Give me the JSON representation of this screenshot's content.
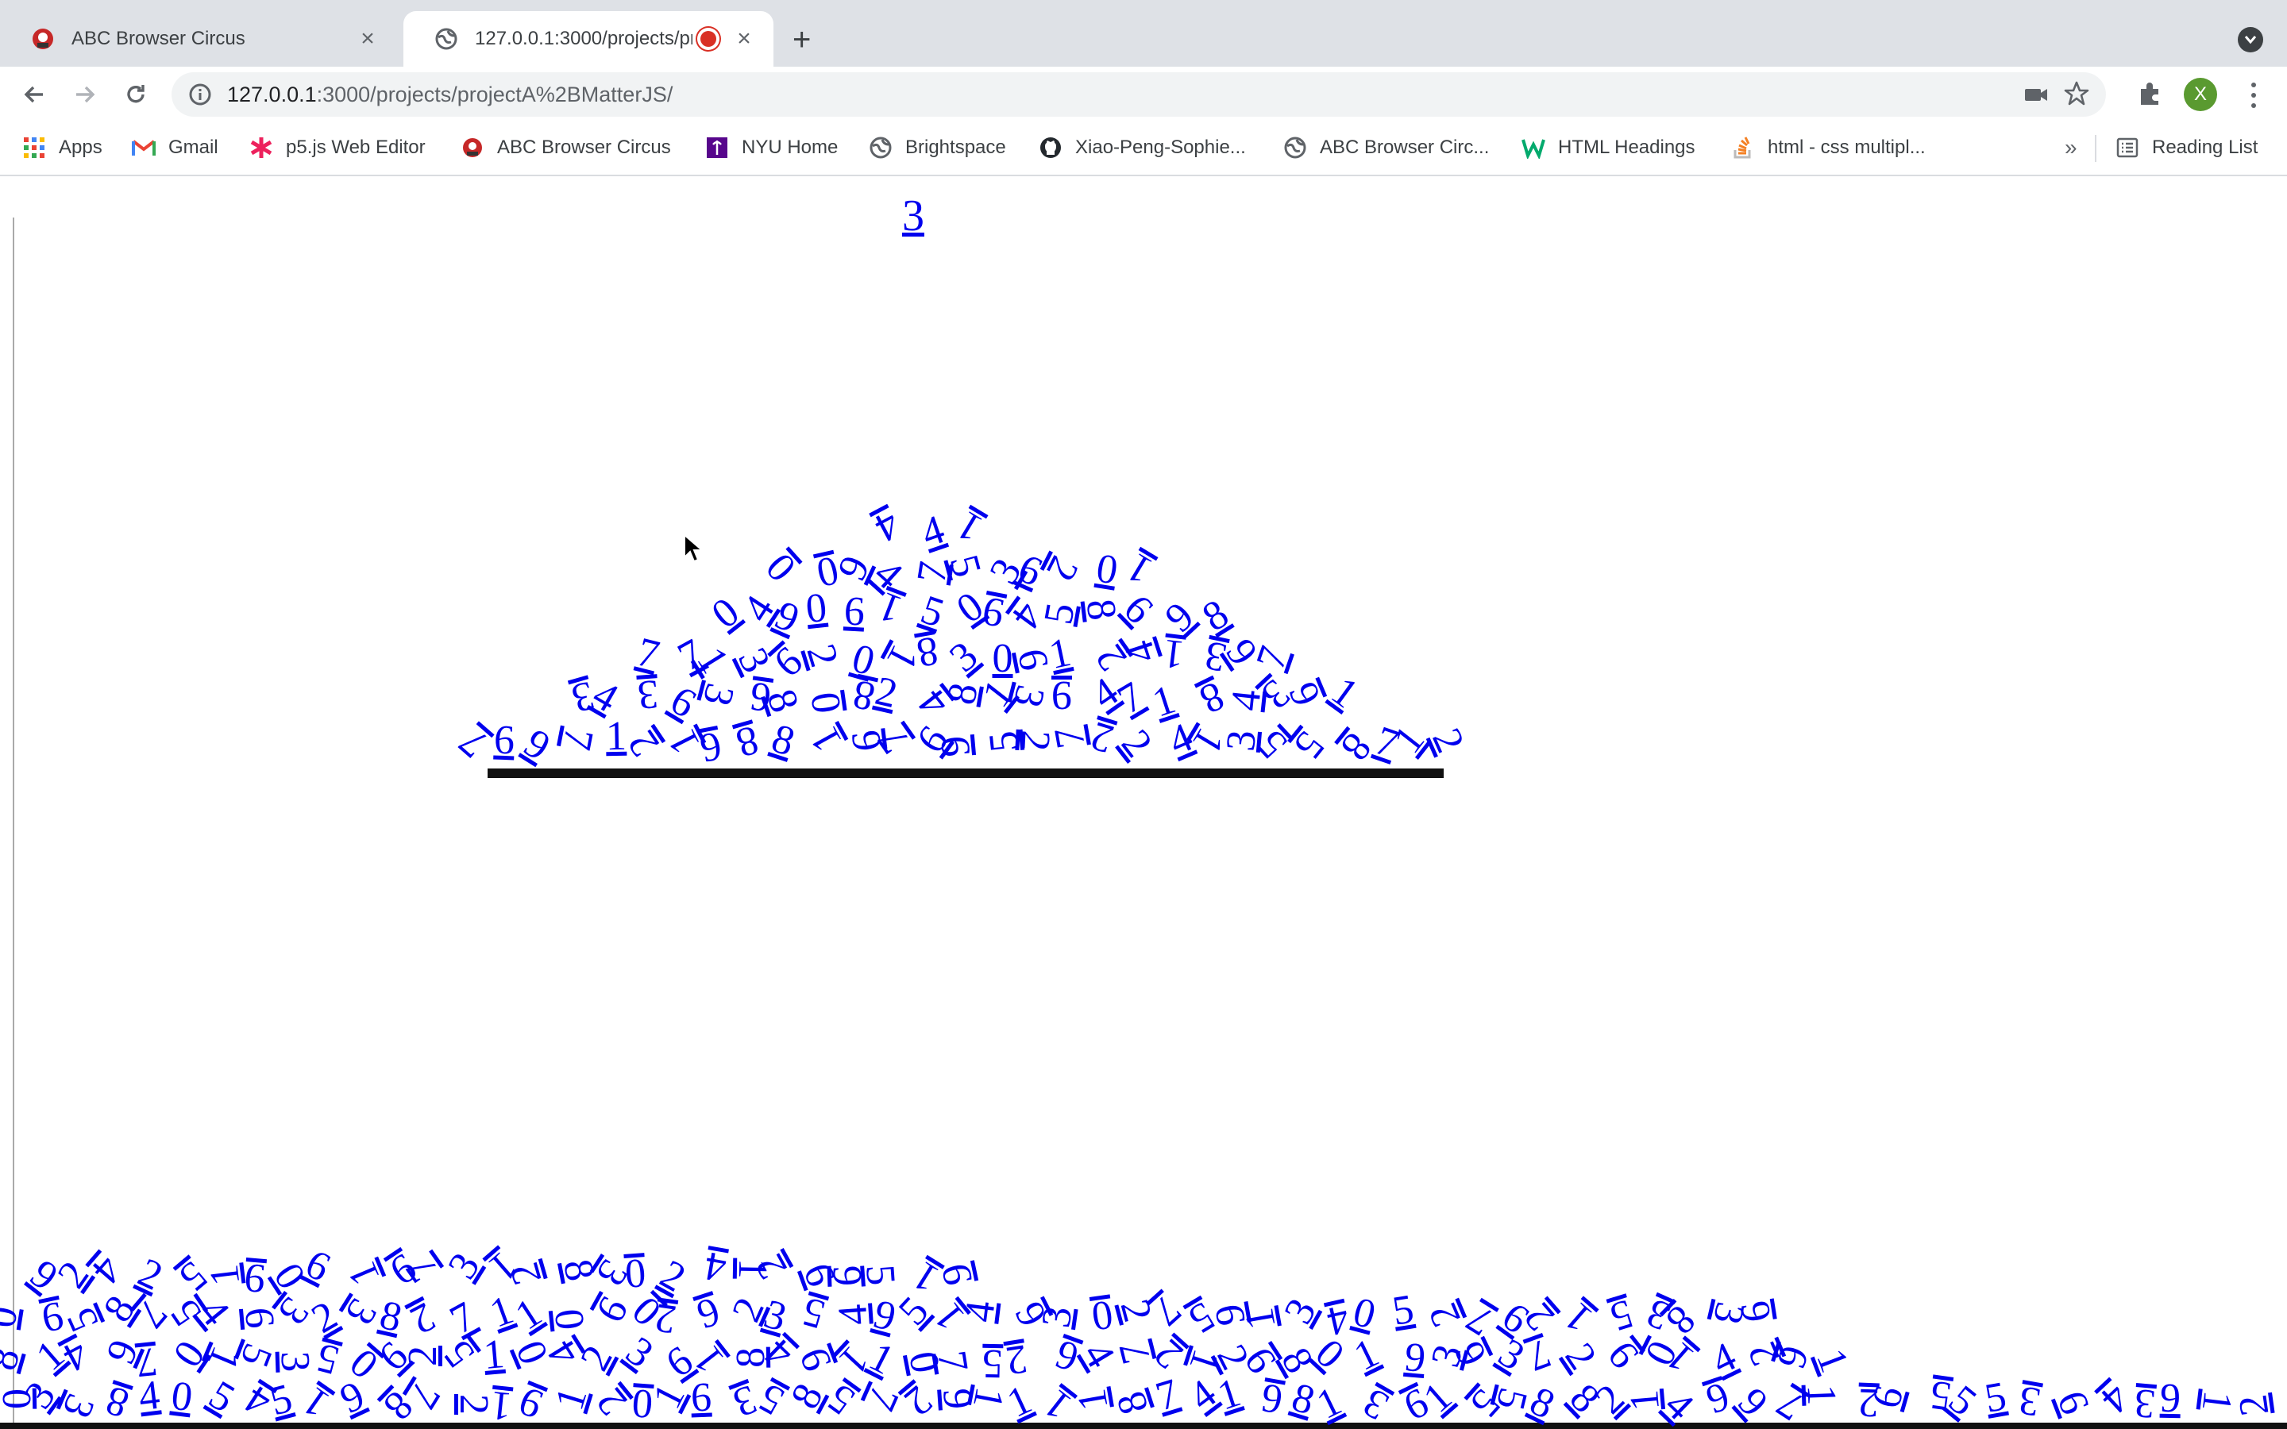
{
  "browser": {
    "tabs": [
      {
        "title": "ABC Browser Circus",
        "active": false
      },
      {
        "title": "127.0.0.1:3000/projects/pr",
        "active": true,
        "recording": true
      }
    ],
    "address": {
      "host": "127.0.0.1",
      "rest": ":3000/projects/projectA%2BMatterJS/"
    },
    "profile_initial": "X"
  },
  "bookmarks": [
    {
      "label": "Apps",
      "icon": "apps-grid-icon"
    },
    {
      "label": "Gmail",
      "icon": "gmail-icon"
    },
    {
      "label": "p5.js Web Editor",
      "icon": "p5js-icon"
    },
    {
      "label": "ABC Browser Circus",
      "icon": "circus-icon"
    },
    {
      "label": "NYU Home",
      "icon": "nyu-icon"
    },
    {
      "label": "Brightspace",
      "icon": "globe-icon"
    },
    {
      "label": "Xiao-Peng-Sophie...",
      "icon": "github-icon"
    },
    {
      "label": "ABC Browser Circ...",
      "icon": "globe-icon"
    },
    {
      "label": "HTML Headings",
      "icon": "w3schools-icon"
    },
    {
      "label": "html - css multipl...",
      "icon": "stackoverflow-icon"
    }
  ],
  "bookmarks_overflow": "»",
  "reading_list": "Reading List",
  "page": {
    "counter": "3",
    "link_color": "#0000ee",
    "upper_pile": "7697121688167695272241355871234363680824813947184361771392018306124139704906150945869800947536201441",
    "lower_pile": "0338405451987219120163585729111187416813915588214697126555364391281497015350625104236184911075264721298019363729014261095875463238271109026235495146302759134052762153836924251906197312830241269519"
  }
}
